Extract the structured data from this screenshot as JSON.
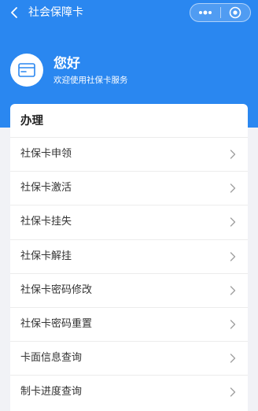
{
  "navbar": {
    "title": "社会保障卡",
    "back_icon": "chevron-left-icon",
    "more_icon": "more-dots-icon",
    "close_icon": "target-circle-icon"
  },
  "header": {
    "greeting": "您好",
    "subtitle": "欢迎使用社保卡服务",
    "avatar_icon": "card-icon"
  },
  "section": {
    "title": "办理",
    "items": [
      {
        "label": "社保卡申领"
      },
      {
        "label": "社保卡激活"
      },
      {
        "label": "社保卡挂失"
      },
      {
        "label": "社保卡解挂"
      },
      {
        "label": "社保卡密码修改"
      },
      {
        "label": "社保卡密码重置"
      },
      {
        "label": "卡面信息查询"
      },
      {
        "label": "制卡进度查询"
      }
    ]
  },
  "colors": {
    "primary": "#2a87f0",
    "background": "#f1f2f6",
    "card": "#ffffff",
    "text": "#333333",
    "chevron": "#a0a0a0"
  }
}
